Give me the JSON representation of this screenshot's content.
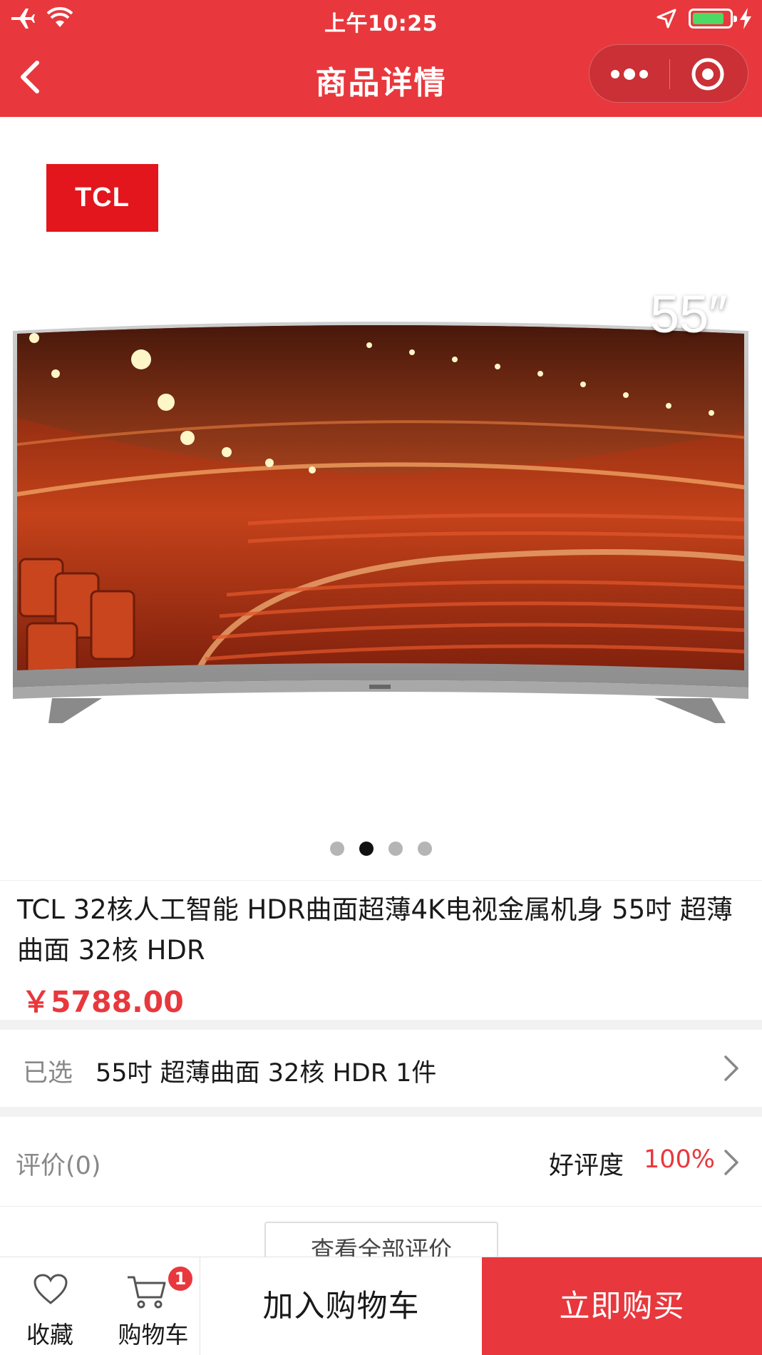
{
  "status_bar": {
    "time": "上午10:25",
    "battery_level": 0.85,
    "icons": [
      "airplane-icon",
      "wifi-icon",
      "location-arrow-icon",
      "battery-icon",
      "charging-bolt-icon"
    ]
  },
  "nav": {
    "title": "商品详情",
    "icons": [
      "back-chevron-icon",
      "more-dots-icon",
      "close-target-icon"
    ]
  },
  "gallery": {
    "brand": "TCL",
    "screen_size": "55″",
    "slide_count": 4,
    "active_slide": 1
  },
  "product": {
    "name": "TCL 32核人工智能 HDR曲面超薄4K电视金属机身 55吋 超薄曲面 32核 HDR",
    "price": "￥5788.00"
  },
  "selection": {
    "label": "已选",
    "value": "55吋 超薄曲面 32核 HDR 1件"
  },
  "reviews": {
    "label": "评价(0)",
    "positive_label": "好评度",
    "positive_value": "100%",
    "view_all": "查看全部评价"
  },
  "bottom_bar": {
    "favorite_label": "收藏",
    "cart_label": "购物车",
    "cart_count": "1",
    "add_to_cart": "加入购物车",
    "buy_now": "立即购买"
  },
  "colors": {
    "brand_red": "#e8383d",
    "price_red": "#e8383d",
    "logo_red": "#e3161d"
  }
}
